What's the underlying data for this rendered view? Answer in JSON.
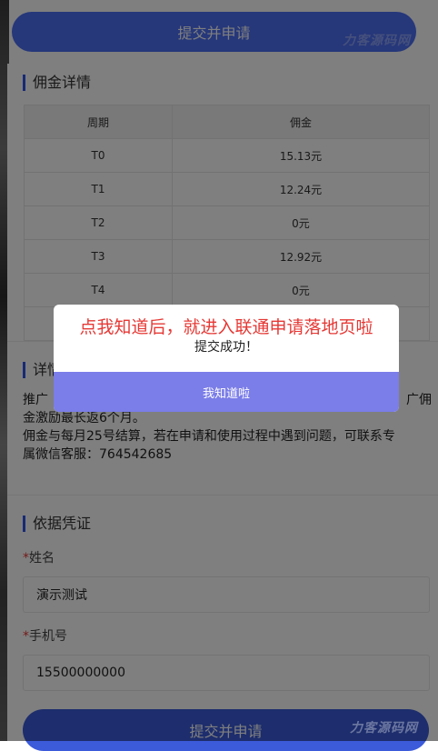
{
  "top_button": {
    "label": "提交并申请"
  },
  "watermark": "力客源码网",
  "commission": {
    "title": "佣金详情",
    "headers": [
      "周期",
      "佣金"
    ],
    "rows": [
      {
        "period": "T0",
        "amount": "15.13元"
      },
      {
        "period": "T1",
        "amount": "12.24元"
      },
      {
        "period": "T2",
        "amount": "0元"
      },
      {
        "period": "T3",
        "amount": "12.92元"
      },
      {
        "period": "T4",
        "amount": "0元"
      },
      {
        "period": "",
        "amount": ""
      }
    ]
  },
  "details": {
    "title": "详情",
    "line1_left": "推广",
    "line1_right": "广佣",
    "line2": "金激励最长返6个月。",
    "line3": "佣金与每月25号结算，若在申请和使用过程中遇到问题，可联系专",
    "line4": "属微信客服：764542685"
  },
  "evidence": {
    "title": "依据凭证",
    "name_label": "姓名",
    "name_value": "演示测试",
    "phone_label": "手机号",
    "phone_value": "15500000000",
    "required_mark": "*"
  },
  "bottom_button": {
    "label": "提交并申请"
  },
  "dialog": {
    "title": "点我知道后，就进入联通申请落地页啦",
    "message": "提交成功！",
    "confirm_label": "我知道啦"
  }
}
